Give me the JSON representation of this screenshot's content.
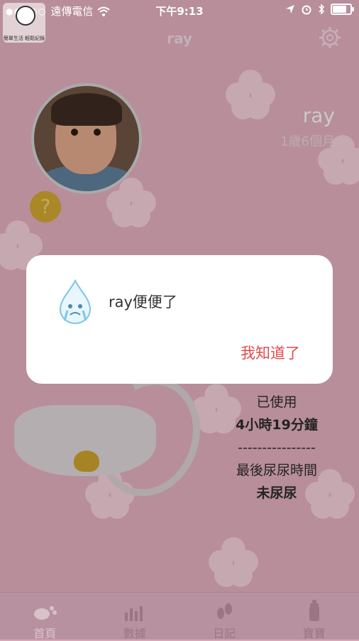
{
  "status_bar": {
    "carrier": "遠傳電信",
    "time": "下午9:13",
    "battery_level_percent": 85
  },
  "watermark": {
    "text": "簡單生活 輕鬆紀錄"
  },
  "nav": {
    "title": "ray"
  },
  "profile": {
    "name": "ray",
    "age": "1歲6個月",
    "help_symbol": "?"
  },
  "info_panel": {
    "used_label": "已使用",
    "used_value": "4小時19分鐘",
    "divider": "----------------",
    "last_pee_label": "最後尿尿時間",
    "last_pee_value": "未尿尿"
  },
  "tabs": [
    {
      "label": "首頁",
      "icon": "footprint-diaper-icon"
    },
    {
      "label": "數據",
      "icon": "bar-chart-icon"
    },
    {
      "label": "日記",
      "icon": "footprints-icon"
    },
    {
      "label": "寶寶",
      "icon": "bottle-icon"
    }
  ],
  "alert": {
    "message": "ray便便了",
    "confirm_label": "我知道了",
    "icon": "water-drop-crying-icon",
    "accent_color": "#e24b4b"
  },
  "colors": {
    "background": "#d7a7b6",
    "flower": "#e9c6d1",
    "tabbar": "#b891a0"
  }
}
